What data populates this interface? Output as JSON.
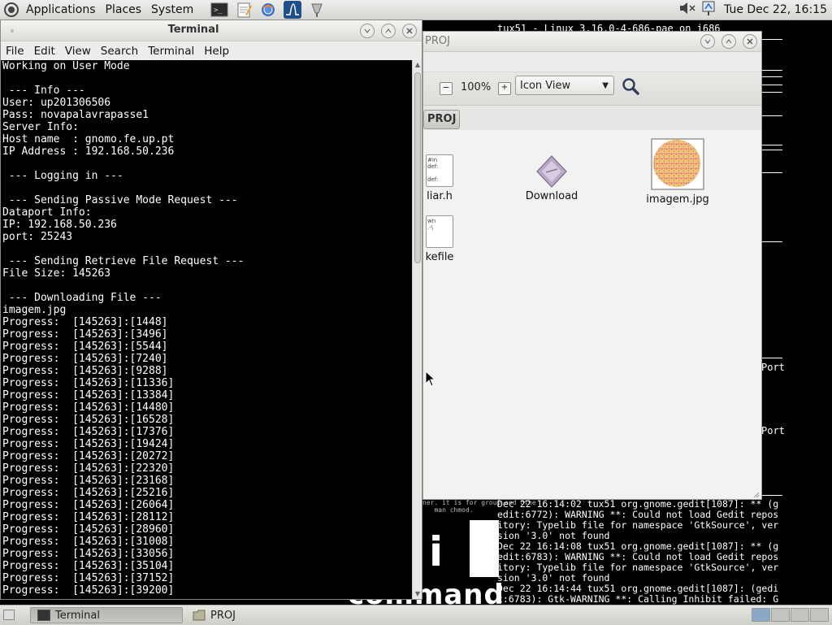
{
  "top_panel": {
    "menus": [
      "Applications",
      "Places",
      "System"
    ],
    "clock": "Tue Dec 22, 16:15",
    "launchers": [
      "terminal-launcher-icon",
      "text-editor-launcher-icon",
      "web-browser-launcher-icon",
      "monitor-launcher-icon",
      "wireshark-launcher-icon"
    ]
  },
  "background": {
    "top_line": "tux51 - Linux 3.16.0-4-686-pae on i686",
    "port_label_1": "Port",
    "port_label_2": "Port",
    "small_text": "ner. it is for group and othe\n   man chmod.",
    "big_letters": "i",
    "big_word": "commands",
    "log_text": "Dec 22 16:14:02 tux51 org.gnome.gedit[1087]: ** (g\nedit:6772): WARNING **: Could not load Gedit repos\nitory: Typelib file for namespace 'GtkSource', ver\nsion '3.0' not found\nDec 22 16:14:08 tux51 org.gnome.gedit[1087]: ** (g\nedit:6783): WARNING **: Could not load Gedit repos\nitory: Typelib file for namespace 'GtkSource', ver\nsion '3.0' not found\nDec 22 16:14:44 tux51 org.gnome.gedit[1087]: (gedi\nt:6783): Gtk-WARNING **: Calling Inhibit failed: G"
  },
  "file_manager": {
    "title": "PROJ",
    "zoom_level": "100%",
    "view_mode": "Icon View",
    "path_button": "PROJ",
    "files": [
      {
        "name": "liar.h",
        "icon": "header-file-icon"
      },
      {
        "name": "Download",
        "icon": "executable-icon"
      },
      {
        "name": "imagem.jpg",
        "icon": "image-thumbnail-icon"
      },
      {
        "name": "kefile",
        "icon": "makefile-icon"
      }
    ]
  },
  "terminal": {
    "title": "Terminal",
    "menus": [
      "File",
      "Edit",
      "View",
      "Search",
      "Terminal",
      "Help"
    ],
    "output": "Working on User Mode\n\n --- Info ---\nUser: up201306506\nPass: novapalavrapasse1\nServer Info:\nHost name  : gnomo.fe.up.pt\nIP Address : 192.168.50.236\n\n --- Logging in ---\n\n --- Sending Passive Mode Request ---\nDataport Info:\nIP: 192.168.50.236\nport: 25243\n\n --- Sending Retrieve File Request ---\nFile Size: 145263\n\n --- Downloading File ---\nimagem.jpg\nProgress:  [145263]:[1448]\nProgress:  [145263]:[3496]\nProgress:  [145263]:[5544]\nProgress:  [145263]:[7240]\nProgress:  [145263]:[9288]\nProgress:  [145263]:[11336]\nProgress:  [145263]:[13384]\nProgress:  [145263]:[14480]\nProgress:  [145263]:[16528]\nProgress:  [145263]:[17376]\nProgress:  [145263]:[19424]\nProgress:  [145263]:[20272]\nProgress:  [145263]:[22320]\nProgress:  [145263]:[23168]\nProgress:  [145263]:[25216]\nProgress:  [145263]:[26064]\nProgress:  [145263]:[28112]\nProgress:  [145263]:[28960]\nProgress:  [145263]:[31008]\nProgress:  [145263]:[33056]\nProgress:  [145263]:[35104]\nProgress:  [145263]:[37152]\nProgress:  [145263]:[39200]"
  },
  "bottom_panel": {
    "tasks": [
      {
        "label": "Terminal",
        "active": true
      },
      {
        "label": "PROJ",
        "active": false
      }
    ],
    "workspaces": 4
  }
}
